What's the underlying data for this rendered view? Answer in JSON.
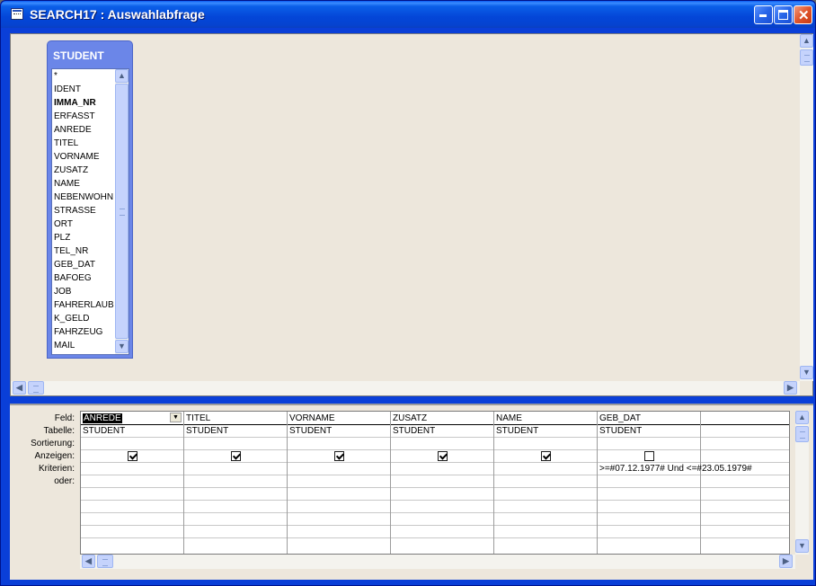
{
  "window": {
    "title": "SEARCH17 : Auswahlabfrage"
  },
  "table": {
    "name": "STUDENT",
    "fields": [
      "*",
      "IDENT",
      "IMMA_NR",
      "ERFASST",
      "ANREDE",
      "TITEL",
      "VORNAME",
      "ZUSATZ",
      "NAME",
      "NEBENWOHN",
      "STRASSE",
      "ORT",
      "PLZ",
      "TEL_NR",
      "GEB_DAT",
      "BAFOEG",
      "JOB",
      "FAHRERLAUB",
      "K_GELD",
      "FAHRZEUG",
      "MAIL"
    ],
    "key_field": "IMMA_NR"
  },
  "grid": {
    "row_labels": [
      "Feld:",
      "Tabelle:",
      "Sortierung:",
      "Anzeigen:",
      "Kriterien:",
      "oder:"
    ],
    "columns": [
      {
        "field": "ANREDE",
        "table": "STUDENT",
        "show": true,
        "criteria": ""
      },
      {
        "field": "TITEL",
        "table": "STUDENT",
        "show": true,
        "criteria": ""
      },
      {
        "field": "VORNAME",
        "table": "STUDENT",
        "show": true,
        "criteria": ""
      },
      {
        "field": "ZUSATZ",
        "table": "STUDENT",
        "show": true,
        "criteria": ""
      },
      {
        "field": "NAME",
        "table": "STUDENT",
        "show": true,
        "criteria": ""
      },
      {
        "field": "GEB_DAT",
        "table": "STUDENT",
        "show": false,
        "criteria": ">=#07.12.1977# Und <=#23.05.1979#"
      }
    ]
  },
  "icons": {
    "window": "query-icon",
    "minimize": "minimize-icon",
    "maximize": "maximize-icon",
    "close": "close-icon",
    "scroll_up": "up-arrow-icon",
    "scroll_down": "down-arrow-icon",
    "scroll_left": "left-arrow-icon",
    "scroll_right": "right-arrow-icon",
    "dropdown": "dropdown-arrow-icon"
  }
}
